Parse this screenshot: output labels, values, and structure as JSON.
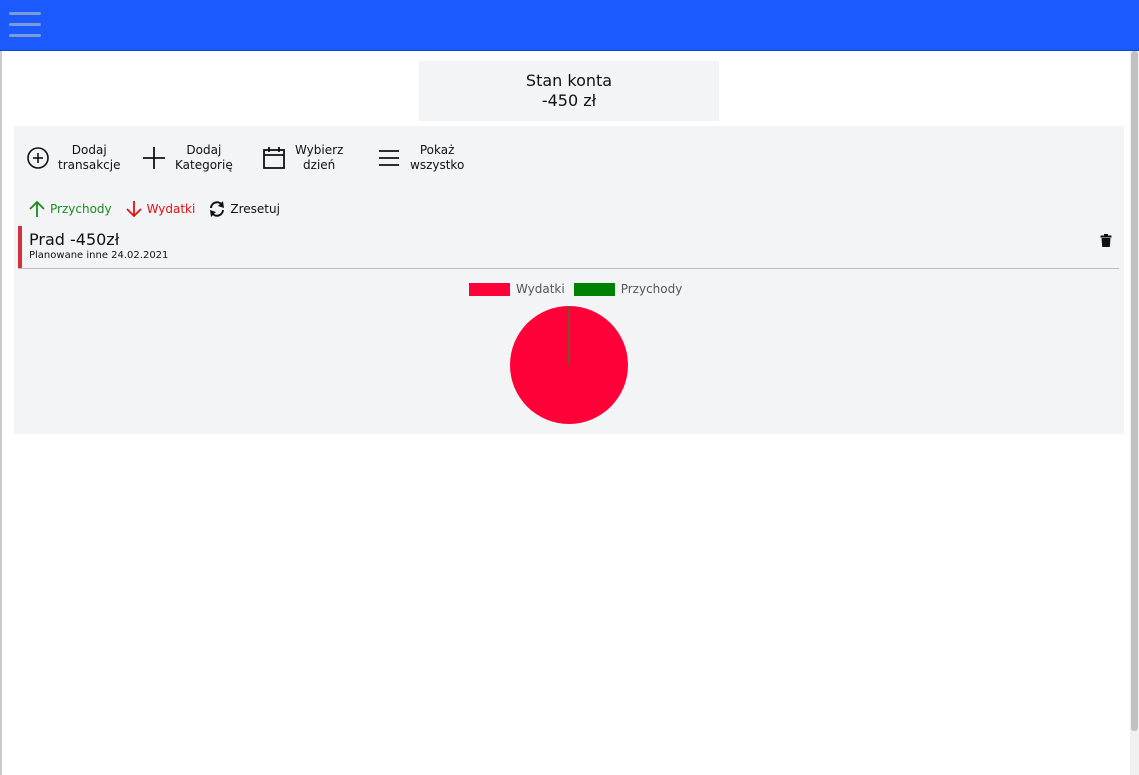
{
  "header": {
    "menu_icon": "hamburger-icon"
  },
  "balance": {
    "title": "Stan konta",
    "value": "-450 zł"
  },
  "toolbar": {
    "add_transaction": {
      "label": "Dodaj\ntransakcje",
      "icon": "plus-circle-icon"
    },
    "add_category": {
      "label": "Dodaj\nKategorię",
      "icon": "plus-icon"
    },
    "choose_day": {
      "label": "Wybierz\ndzień",
      "icon": "calendar-icon"
    },
    "show_all": {
      "label": "Pokaż\nwszystko",
      "icon": "list-icon"
    }
  },
  "filters": {
    "income": {
      "label": "Przychody",
      "icon": "arrow-up-icon",
      "color": "#1a8c1a"
    },
    "expenses": {
      "label": "Wydatki",
      "icon": "arrow-down-icon",
      "color": "#e01010"
    },
    "reset": {
      "label": "Zresetuj",
      "icon": "refresh-icon"
    }
  },
  "transactions": [
    {
      "title": "Prad -450zł",
      "subtitle": "Planowane  inne  24.02.2021",
      "accent": "#d0323e",
      "delete_icon": "trash-icon"
    }
  ],
  "chart_data": {
    "type": "pie",
    "legend_position": "top",
    "series": [
      {
        "name": "Wydatki",
        "value": 450,
        "color": "#ff0039"
      },
      {
        "name": "Przychody",
        "value": 0,
        "color": "#008000"
      }
    ]
  }
}
